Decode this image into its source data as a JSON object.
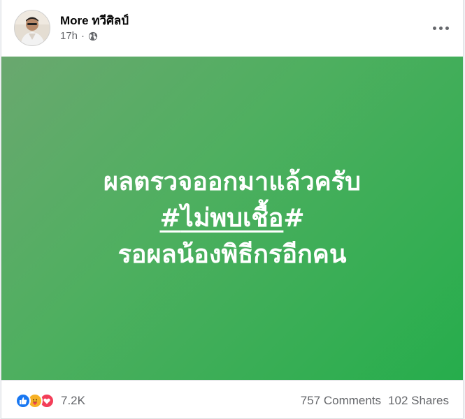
{
  "post": {
    "author": "More ทวีศิลป์",
    "time": "17h",
    "separator": "·",
    "privacy_icon": "globe-icon",
    "more_icon": "more-dots-icon"
  },
  "banner": {
    "background_colors": [
      "#6aa86f",
      "#26ad4c"
    ],
    "line1": "ผลตรวจออกมาแล้วครับ",
    "line2_prefix": "#",
    "line2_hashtag": "ไม่พบเชื้อ",
    "line2_suffix": "#",
    "line3": "รอผลน้องพิธีกรอีกคน"
  },
  "footer": {
    "reaction_icons": [
      "like-icon",
      "care-icon",
      "love-icon"
    ],
    "reaction_count": "7.2K",
    "comments": "757 Comments",
    "shares": "102 Shares"
  },
  "colors": {
    "like": "#1877f2",
    "care": "#f7b125",
    "love": "#f33e58",
    "secondary_text": "#65676b"
  }
}
